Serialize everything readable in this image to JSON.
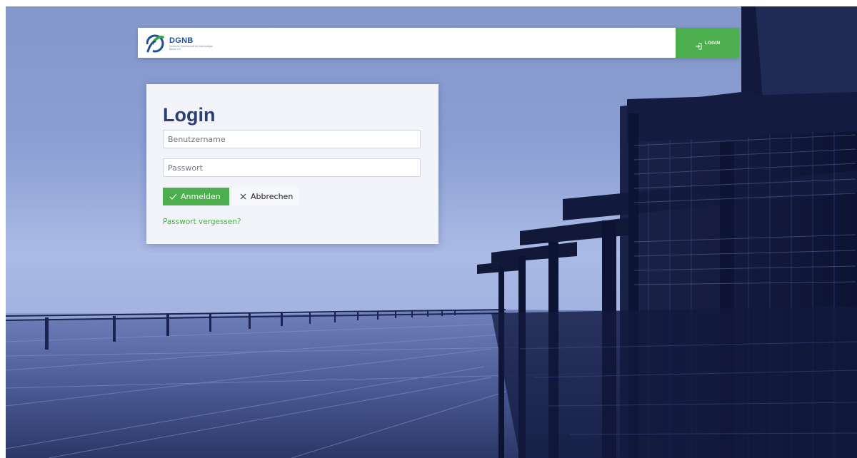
{
  "header": {
    "logo_word": "DGNB",
    "logo_sub": "Deutsche Gesellschaft für Nachhaltiges Bauen e.V.",
    "login_button_label": "LOGIN"
  },
  "login_form": {
    "title": "Login",
    "username_placeholder": "Benutzername",
    "password_placeholder": "Passwort",
    "submit_label": "Anmelden",
    "cancel_label": "Abbrechen",
    "forgot_password_label": "Passwort vergessen?"
  },
  "colors": {
    "accent_green": "#4cae4c",
    "title_navy": "#2c3e73",
    "brand_blue": "#1d4f91"
  },
  "icons": {
    "logo": "dgnb-logo-icon",
    "top_login": "login-enter-icon",
    "submit": "checkmark-icon",
    "cancel": "close-icon"
  }
}
